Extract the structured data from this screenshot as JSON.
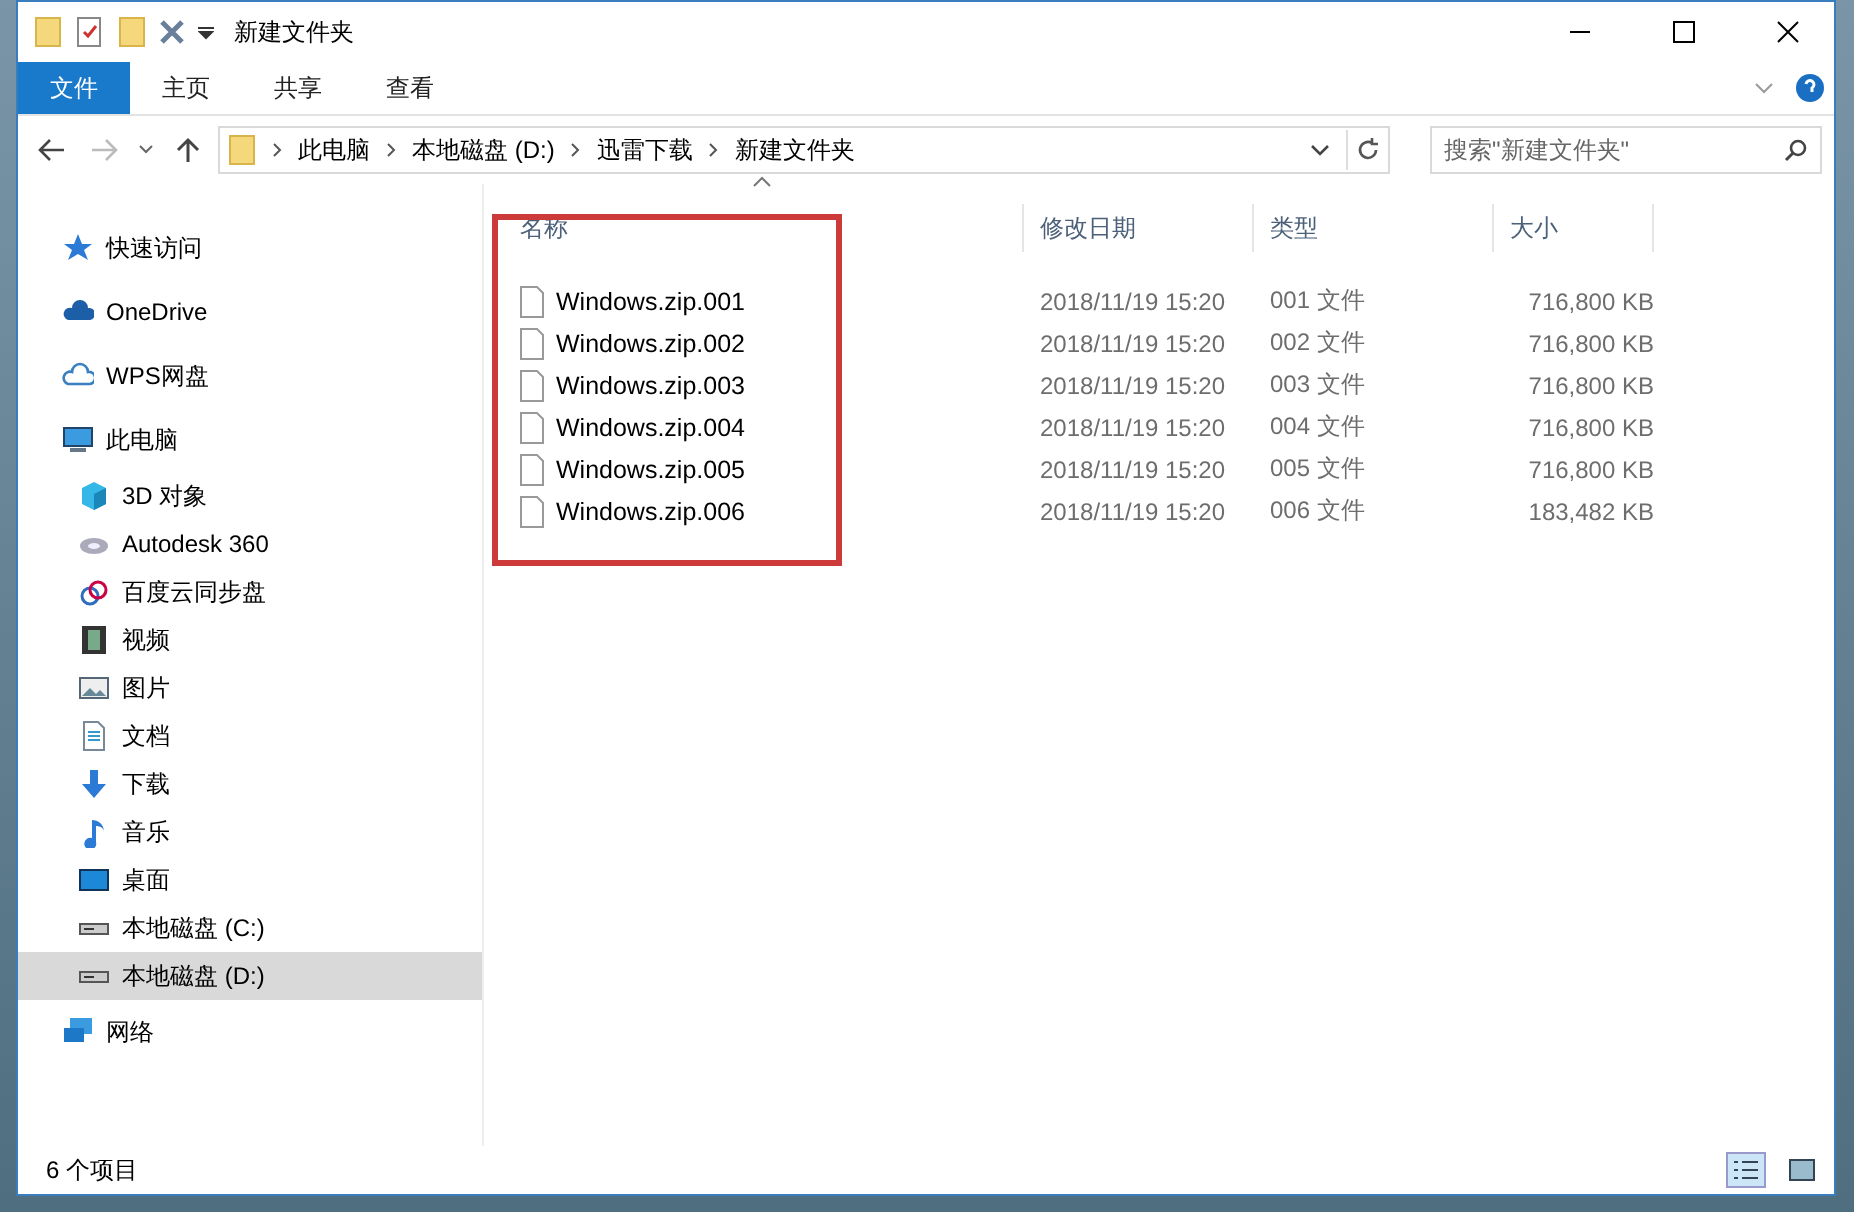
{
  "window": {
    "title": "新建文件夹"
  },
  "ribbon_tabs": [
    {
      "label": "文件",
      "selected": true
    },
    {
      "label": "主页",
      "selected": false
    },
    {
      "label": "共享",
      "selected": false
    },
    {
      "label": "查看",
      "selected": false
    }
  ],
  "breadcrumb": [
    "此电脑",
    "本地磁盘 (D:)",
    "迅雷下载",
    "新建文件夹"
  ],
  "search": {
    "placeholder": "搜索\"新建文件夹\""
  },
  "sidebar": {
    "items": [
      {
        "label": "快速访问",
        "kind": "star",
        "selected": false
      },
      {
        "label": "OneDrive",
        "kind": "cloud",
        "selected": false
      },
      {
        "label": "WPS网盘",
        "kind": "cloud-outline",
        "selected": false
      },
      {
        "label": "此电脑",
        "kind": "computer",
        "selected": false,
        "children": [
          {
            "label": "3D 对象",
            "kind": "cube",
            "selected": false
          },
          {
            "label": "Autodesk 360",
            "kind": "disc",
            "selected": false
          },
          {
            "label": "百度云同步盘",
            "kind": "sync",
            "selected": false
          },
          {
            "label": "视频",
            "kind": "film",
            "selected": false
          },
          {
            "label": "图片",
            "kind": "picture",
            "selected": false
          },
          {
            "label": "文档",
            "kind": "document",
            "selected": false
          },
          {
            "label": "下载",
            "kind": "download",
            "selected": false
          },
          {
            "label": "音乐",
            "kind": "music",
            "selected": false
          },
          {
            "label": "桌面",
            "kind": "desktop",
            "selected": false
          },
          {
            "label": "本地磁盘 (C:)",
            "kind": "drive",
            "selected": false
          },
          {
            "label": "本地磁盘 (D:)",
            "kind": "drive",
            "selected": true
          }
        ]
      },
      {
        "label": "网络",
        "kind": "network",
        "selected": false
      }
    ]
  },
  "table": {
    "columns": [
      "名称",
      "修改日期",
      "类型",
      "大小"
    ],
    "rows": [
      [
        "Windows.zip.001",
        "2018/11/19 15:20",
        "001 文件",
        "716,800 KB"
      ],
      [
        "Windows.zip.002",
        "2018/11/19 15:20",
        "002 文件",
        "716,800 KB"
      ],
      [
        "Windows.zip.003",
        "2018/11/19 15:20",
        "003 文件",
        "716,800 KB"
      ],
      [
        "Windows.zip.004",
        "2018/11/19 15:20",
        "004 文件",
        "716,800 KB"
      ],
      [
        "Windows.zip.005",
        "2018/11/19 15:20",
        "005 文件",
        "716,800 KB"
      ],
      [
        "Windows.zip.006",
        "2018/11/19 15:20",
        "006 文件",
        "183,482 KB"
      ]
    ]
  },
  "status_bar": {
    "count": "6 个项目"
  }
}
